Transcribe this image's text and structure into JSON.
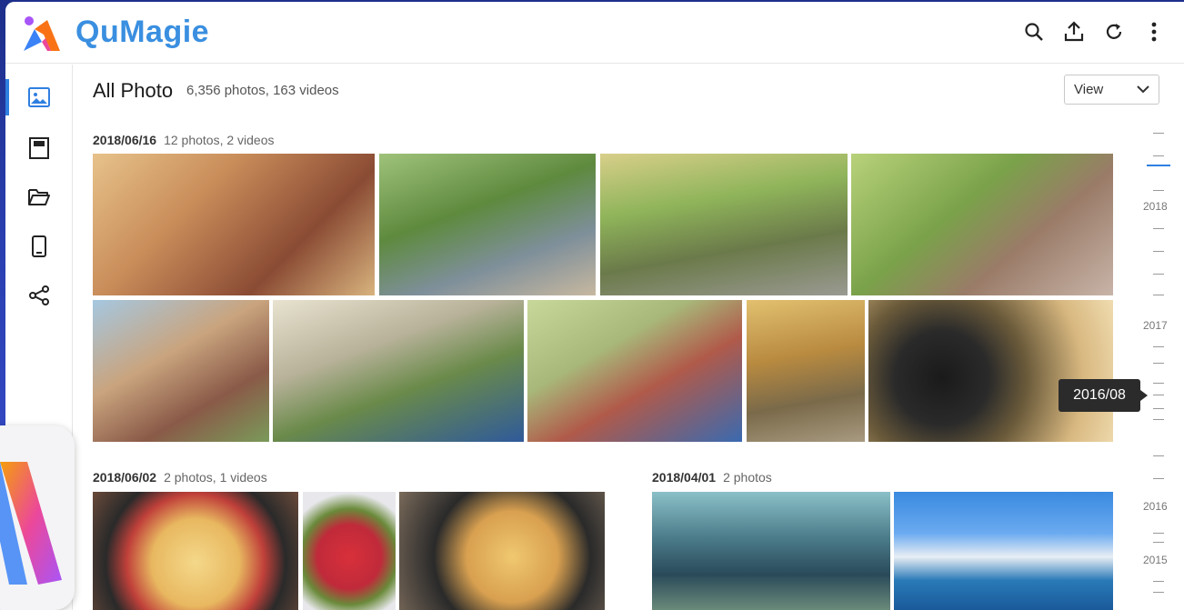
{
  "app": {
    "brand": "QuMagie"
  },
  "topbar": {
    "icons": [
      "search-icon",
      "upload-icon",
      "refresh-icon",
      "more-vertical-icon"
    ]
  },
  "sidebar": {
    "items": [
      {
        "icon": "photos-icon",
        "active": true
      },
      {
        "icon": "album-icon",
        "active": false
      },
      {
        "icon": "folder-icon",
        "active": false
      },
      {
        "icon": "device-icon",
        "active": false
      },
      {
        "icon": "share-icon",
        "active": false
      }
    ]
  },
  "header": {
    "title": "All Photo",
    "subtitle": "6,356 photos, 163 videos",
    "view_label": "View"
  },
  "groups": [
    {
      "date": "2018/06/16",
      "count": "12 photos, 2 videos"
    },
    {
      "date": "2018/06/02",
      "count": "2 photos, 1 videos"
    },
    {
      "date": "2018/04/01",
      "count": "2 photos"
    }
  ],
  "timeline": {
    "years": [
      "2018",
      "2017",
      "2016",
      "2015"
    ],
    "tooltip": "2016/08"
  },
  "colors": {
    "accent": "#2f7fe0",
    "brand": "#3a8fe0"
  }
}
